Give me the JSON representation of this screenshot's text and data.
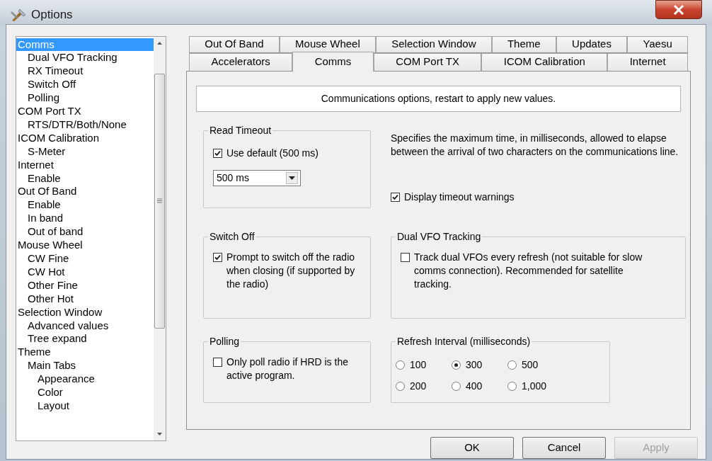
{
  "window": {
    "title": "Options"
  },
  "tree": {
    "items": [
      {
        "label": "Comms",
        "selected": true,
        "children": [
          {
            "label": "Dual VFO Tracking",
            "selected": false
          },
          {
            "label": "RX Timeout",
            "selected": false
          },
          {
            "label": "Switch Off",
            "selected": false
          },
          {
            "label": "Polling",
            "selected": false
          }
        ]
      },
      {
        "label": "COM Port TX",
        "selected": false,
        "children": [
          {
            "label": "RTS/DTR/Both/None",
            "selected": false
          }
        ]
      },
      {
        "label": "ICOM Calibration",
        "selected": false,
        "children": [
          {
            "label": "S-Meter",
            "selected": false
          }
        ]
      },
      {
        "label": "Internet",
        "selected": false,
        "children": [
          {
            "label": "Enable",
            "selected": false
          }
        ]
      },
      {
        "label": "Out Of Band",
        "selected": false,
        "children": [
          {
            "label": "Enable",
            "selected": false
          },
          {
            "label": "In band",
            "selected": false
          },
          {
            "label": "Out of band",
            "selected": false
          }
        ]
      },
      {
        "label": "Mouse Wheel",
        "selected": false,
        "children": [
          {
            "label": "CW Fine",
            "selected": false
          },
          {
            "label": "CW Hot",
            "selected": false
          },
          {
            "label": "Other Fine",
            "selected": false
          },
          {
            "label": "Other Hot",
            "selected": false
          }
        ]
      },
      {
        "label": "Selection Window",
        "selected": false,
        "children": [
          {
            "label": "Advanced values",
            "selected": false
          },
          {
            "label": "Tree expand",
            "selected": false
          }
        ]
      },
      {
        "label": "Theme",
        "selected": false,
        "children": [
          {
            "label": "Main Tabs",
            "selected": false,
            "children": [
              {
                "label": "Appearance",
                "selected": false
              },
              {
                "label": "Color",
                "selected": false
              },
              {
                "label": "Layout",
                "selected": false
              }
            ]
          }
        ]
      }
    ]
  },
  "tab_rows": [
    [
      {
        "label": "Out Of Band",
        "selected": false
      },
      {
        "label": "Mouse Wheel",
        "selected": false
      },
      {
        "label": "Selection Window",
        "selected": false
      },
      {
        "label": "Theme",
        "selected": false
      },
      {
        "label": "Updates",
        "selected": false
      },
      {
        "label": "Yaesu",
        "selected": false
      }
    ],
    [
      {
        "label": "Accelerators",
        "selected": false
      },
      {
        "label": "Comms",
        "selected": true
      },
      {
        "label": "COM Port TX",
        "selected": false
      },
      {
        "label": "ICOM Calibration",
        "selected": false
      },
      {
        "label": "Internet",
        "selected": false
      }
    ]
  ],
  "description": "Communications options, restart to apply new values.",
  "read_timeout": {
    "title": "Read Timeout",
    "checkbox": {
      "label": "Use default (500 ms)",
      "checked": true
    },
    "dropdown": {
      "value": "500 ms"
    }
  },
  "timeout_help": "Specifies the maximum time, in milliseconds, allowed to elapse between the arrival of two characters on the communications line.",
  "timeout_warnings": {
    "label": "Display timeout warnings",
    "checked": true
  },
  "switch_off": {
    "title": "Switch Off",
    "checkbox": {
      "label": "Prompt to switch off the radio when closing (if supported by the radio)",
      "checked": true
    }
  },
  "dual_vfo": {
    "title": "Dual VFO Tracking",
    "checkbox": {
      "label": "Track dual VFOs every refresh (not suitable for slow comms connection). Recommended for satellite tracking.",
      "checked": false
    }
  },
  "polling": {
    "title": "Polling",
    "checkbox": {
      "label": "Only poll radio if HRD is the active program.",
      "checked": false
    }
  },
  "refresh_interval": {
    "title": "Refresh Interval (milliseconds)",
    "options": [
      {
        "label": "100",
        "selected": false
      },
      {
        "label": "300",
        "selected": true
      },
      {
        "label": "500",
        "selected": false
      },
      {
        "label": "200",
        "selected": false
      },
      {
        "label": "400",
        "selected": false
      },
      {
        "label": "1,000",
        "selected": false
      }
    ]
  },
  "buttons": [
    {
      "label": "OK",
      "disabled": false
    },
    {
      "label": "Cancel",
      "disabled": false
    },
    {
      "label": "Apply",
      "disabled": true
    }
  ]
}
